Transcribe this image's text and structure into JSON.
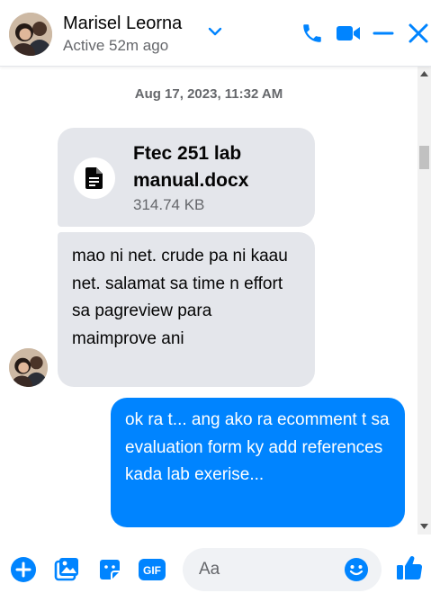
{
  "header": {
    "contact_name": "Marisel Leorna",
    "status": "Active 52m ago"
  },
  "conversation": {
    "timestamp": "Aug 17, 2023, 11:32 AM",
    "file": {
      "name": "Ftec 251 lab manual.docx",
      "size": "314.74 KB",
      "icon": "document-icon"
    },
    "incoming_message": "mao ni net. crude pa ni kaau net. salamat sa time n effort sa pagreview para maimprove ani",
    "outgoing_message": "ok ra t... ang ako ra ecomment t sa evaluation form ky add references kada lab exerise..."
  },
  "composer": {
    "placeholder": "Aa"
  },
  "colors": {
    "accent": "#0084ff",
    "incoming_bubble": "#e4e6eb",
    "secondary_text": "#65676b"
  }
}
